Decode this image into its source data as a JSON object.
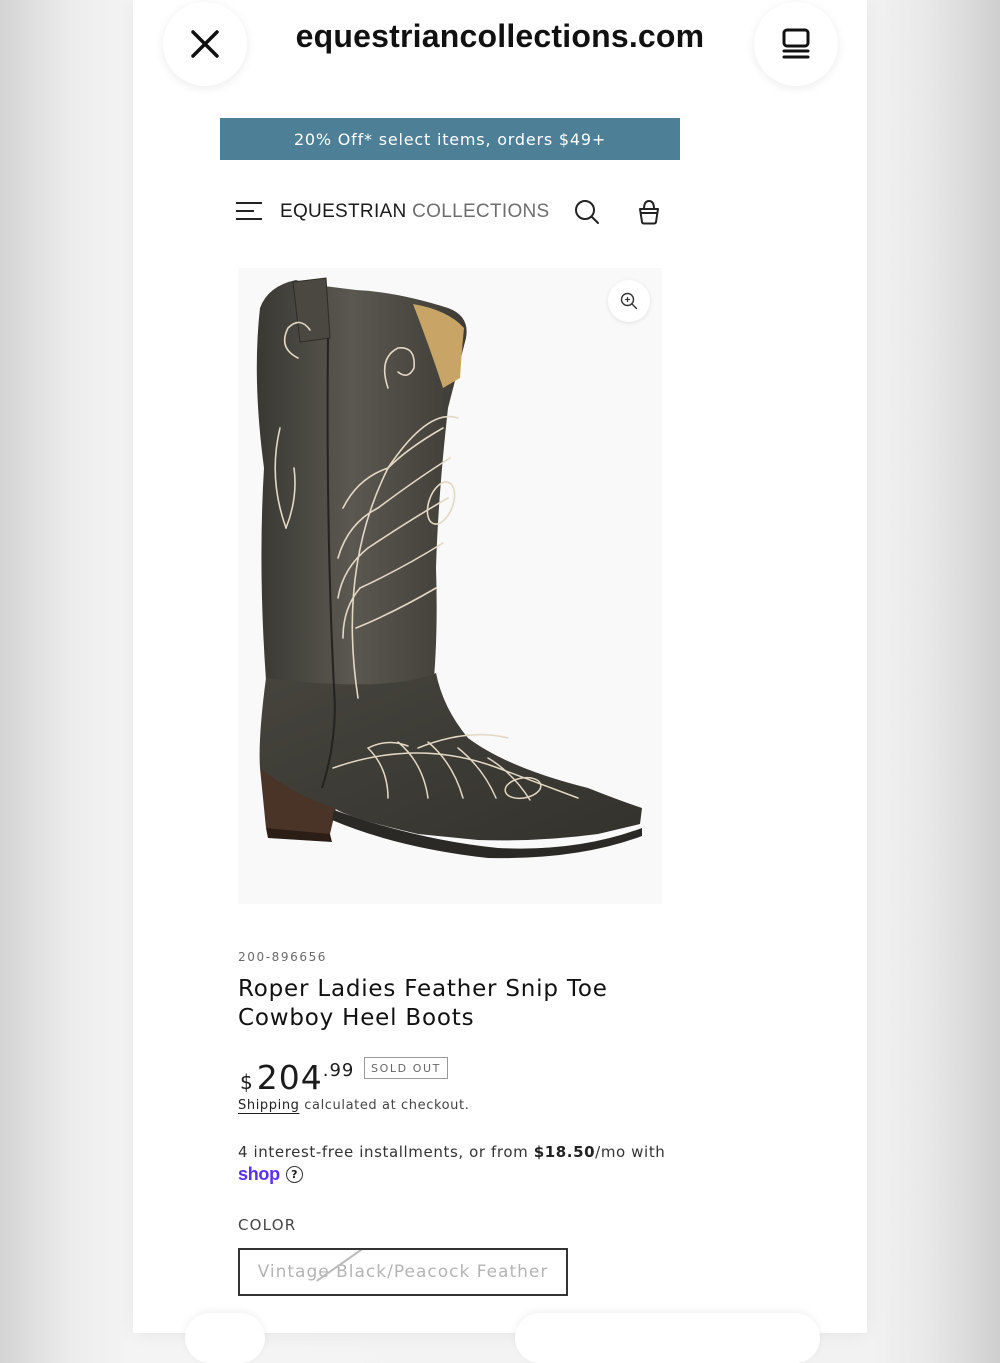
{
  "browser": {
    "url": "equestriancollections.com",
    "close_icon": "close-icon",
    "tabs_icon": "tabs-icon"
  },
  "promo_banner": {
    "text": "20% Off* select items, orders $49+",
    "background": "#4d7f97"
  },
  "header": {
    "logo_primary": "EQUESTRIAN",
    "logo_secondary": "COLLECTIONS",
    "menu_icon": "hamburger-menu-icon",
    "search_icon": "search-icon",
    "cart_icon": "shopping-bag-icon"
  },
  "product": {
    "sku": "200-896656",
    "title": "Roper Ladies Feather Snip Toe Cowboy Heel Boots",
    "price_currency": "$",
    "price_whole": "204",
    "price_cents": ".99",
    "status_badge": "SOLD OUT",
    "shipping_link": "Shipping",
    "shipping_text": "calculated at checkout.",
    "installments_prefix": "4 interest-free installments, or from ",
    "installments_amount": "$18.50",
    "installments_suffix": "/mo with",
    "shop_pay_label": "shop",
    "color_label": "COLOR",
    "color_option": "Vintage Black/Peacock Feather",
    "image_alt": "Roper Ladies Feather Snip Toe Cowboy Heel Boots",
    "zoom_icon": "zoom-in-icon"
  },
  "colors": {
    "accent": "#4d7f97",
    "shop_pay": "#5a31f4"
  }
}
